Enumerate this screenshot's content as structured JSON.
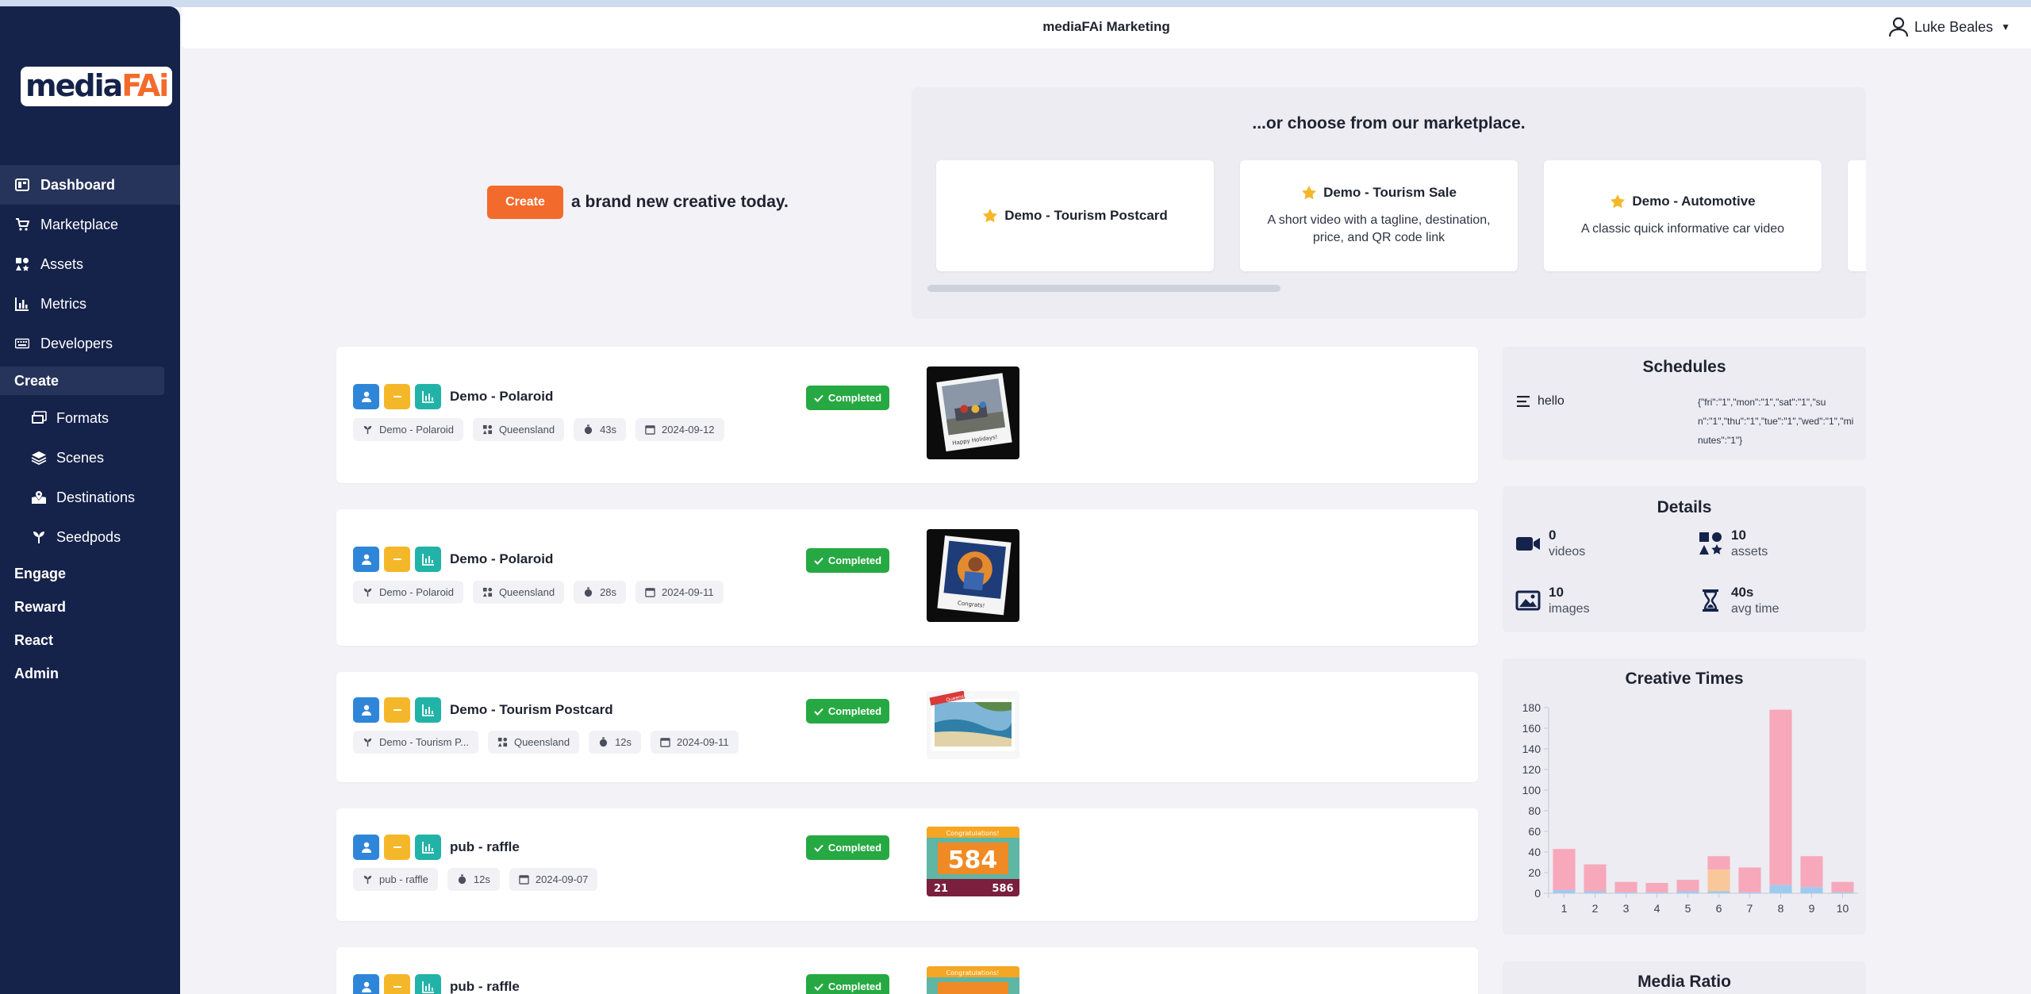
{
  "app": {
    "title": "mediaFAi Marketing",
    "user": "Luke Beales",
    "logo_main": "media",
    "logo_accent": "FAi"
  },
  "sidebar": {
    "items": [
      {
        "label": "Dashboard",
        "icon": "dashboard-icon",
        "active": true
      },
      {
        "label": "Marketplace",
        "icon": "cart-icon"
      },
      {
        "label": "Assets",
        "icon": "assets-icon"
      },
      {
        "label": "Metrics",
        "icon": "chart-icon"
      },
      {
        "label": "Developers",
        "icon": "keyboard-icon"
      }
    ],
    "create_section": "Create",
    "create_items": [
      {
        "label": "Formats",
        "icon": "formats-icon"
      },
      {
        "label": "Scenes",
        "icon": "layers-icon"
      },
      {
        "label": "Destinations",
        "icon": "map-icon"
      },
      {
        "label": "Seedpods",
        "icon": "seedpod-icon"
      }
    ],
    "sections": [
      "Engage",
      "Reward",
      "React",
      "Admin"
    ]
  },
  "create": {
    "button": "Create",
    "text": "a brand new creative today."
  },
  "marketplace": {
    "title": "...or choose from our marketplace.",
    "cards": [
      {
        "title": "Demo - Tourism Postcard",
        "desc": ""
      },
      {
        "title": "Demo - Tourism Sale",
        "desc": "A short video with a tagline, destination, price, and QR code link"
      },
      {
        "title": "Demo - Automotive",
        "desc": "A classic quick informative car video"
      }
    ]
  },
  "creatives": [
    {
      "title": "Demo - Polaroid",
      "status": "Completed",
      "tags": [
        "Demo - Polaroid",
        "Queensland",
        "43s",
        "2024-09-12"
      ]
    },
    {
      "title": "Demo - Polaroid",
      "status": "Completed",
      "tags": [
        "Demo - Polaroid",
        "Queensland",
        "28s",
        "2024-09-11"
      ]
    },
    {
      "title": "Demo - Tourism Postcard",
      "status": "Completed",
      "tags": [
        "Demo - Tourism P...",
        "Queensland",
        "12s",
        "2024-09-11"
      ]
    },
    {
      "title": "pub - raffle",
      "status": "Completed",
      "tags": [
        "pub - raffle",
        "12s",
        "2024-09-07"
      ]
    },
    {
      "title": "pub - raffle",
      "status": "Completed",
      "tags": []
    }
  ],
  "thumb_text": {
    "polaroid1_caption": "Happy Holidays!",
    "polaroid2_caption": "Congrats!",
    "postcard_banner": "Queensland",
    "raffle1_header": "Congratulations!",
    "raffle1_number": "584",
    "raffle1_left": "21",
    "raffle1_right": "586",
    "raffle2_header": "Congratulations!"
  },
  "schedules": {
    "title": "Schedules",
    "name": "hello",
    "value": "{\"fri\":\"1\",\"mon\":\"1\",\"sat\":\"1\",\"sun\":\"1\",\"thu\":\"1\",\"tue\":\"1\",\"wed\":\"1\",\"minutes\":\"1\"}"
  },
  "details": {
    "title": "Details",
    "items": [
      {
        "num": "0",
        "label": "videos",
        "icon": "video-camera-icon"
      },
      {
        "num": "10",
        "label": "assets",
        "icon": "assets-icon"
      },
      {
        "num": "10",
        "label": "images",
        "icon": "image-icon"
      },
      {
        "num": "40s",
        "label": "avg time",
        "icon": "hourglass-icon"
      }
    ]
  },
  "creative_times": {
    "title": "Creative Times"
  },
  "media_ratio": {
    "title": "Media Ratio"
  },
  "colors": {
    "sidebar": "#15224a",
    "accent": "#f26b2c",
    "success": "#26a942",
    "bar_pink": "#f7a8bb",
    "bar_orange": "#f8c89a",
    "bar_blue": "#9ccbef"
  },
  "chart_data": {
    "type": "bar",
    "title": "Creative Times",
    "categories": [
      "1",
      "2",
      "3",
      "4",
      "5",
      "6",
      "7",
      "8",
      "9",
      "10"
    ],
    "series": [
      {
        "values": [
          3,
          2,
          1,
          1,
          2,
          2,
          1,
          8,
          6,
          1
        ],
        "color": "#9ccbef"
      },
      {
        "values": [
          0,
          0,
          0,
          0,
          0,
          21,
          0,
          0,
          0,
          0
        ],
        "color": "#f8c89a"
      },
      {
        "values": [
          40,
          26,
          10,
          9,
          11,
          13,
          24,
          170,
          30,
          10
        ],
        "color": "#f7a8bb"
      }
    ],
    "stacked": true,
    "ylim": [
      0,
      180
    ],
    "yticks": [
      0,
      20,
      40,
      60,
      80,
      100,
      120,
      140,
      160,
      180
    ],
    "grid": false,
    "legend": "none"
  }
}
